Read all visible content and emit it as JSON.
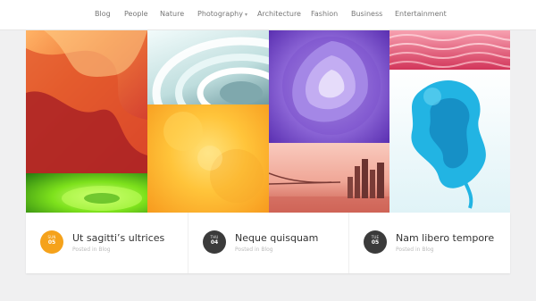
{
  "nav": {
    "items": [
      {
        "label": "Blog"
      },
      {
        "label": "People"
      },
      {
        "label": "Nature"
      },
      {
        "label": "Photography",
        "dropdown_indicator": "▾"
      },
      {
        "label": "Architecture"
      },
      {
        "label": "Fashion"
      },
      {
        "label": "Business"
      },
      {
        "label": "Entertainment"
      }
    ]
  },
  "gallery": {
    "tiles": [
      {
        "name": "antelope-canyon",
        "colors": [
          "#f07b3a",
          "#c8262b"
        ]
      },
      {
        "name": "white-spiral",
        "colors": [
          "#d4ecec",
          "#6f9aa0"
        ]
      },
      {
        "name": "purple-succulent",
        "colors": [
          "#b6a2e8",
          "#6a3cc2"
        ]
      },
      {
        "name": "pink-sand",
        "colors": [
          "#f58a9d",
          "#d2355a"
        ]
      },
      {
        "name": "green-abstract",
        "colors": [
          "#a8f22a",
          "#247a10"
        ]
      },
      {
        "name": "orange-texture",
        "colors": [
          "#ffd24a",
          "#f79a1e"
        ]
      },
      {
        "name": "bridge-sunset",
        "colors": [
          "#f2b3a6",
          "#c9574a"
        ]
      },
      {
        "name": "blue-ink",
        "colors": [
          "#d9f4f9",
          "#1aa6d5"
        ]
      }
    ]
  },
  "posts": [
    {
      "title": "Ut sagitti’s ultrices",
      "meta": "Posted in Blog",
      "badge_day": "SUN",
      "badge_num": "05",
      "badge_color": "#f5a21b"
    },
    {
      "title": "Neque quisquam",
      "meta": "Posted in Blog",
      "badge_day": "THU",
      "badge_num": "04",
      "badge_color": "#3b3b3b"
    },
    {
      "title": "Nam libero tempore",
      "meta": "Posted in Blog",
      "badge_day": "TUE",
      "badge_num": "05",
      "badge_color": "#3b3b3b"
    }
  ],
  "colors": {
    "accent": "#f5a21b",
    "dark": "#3b3b3b"
  }
}
